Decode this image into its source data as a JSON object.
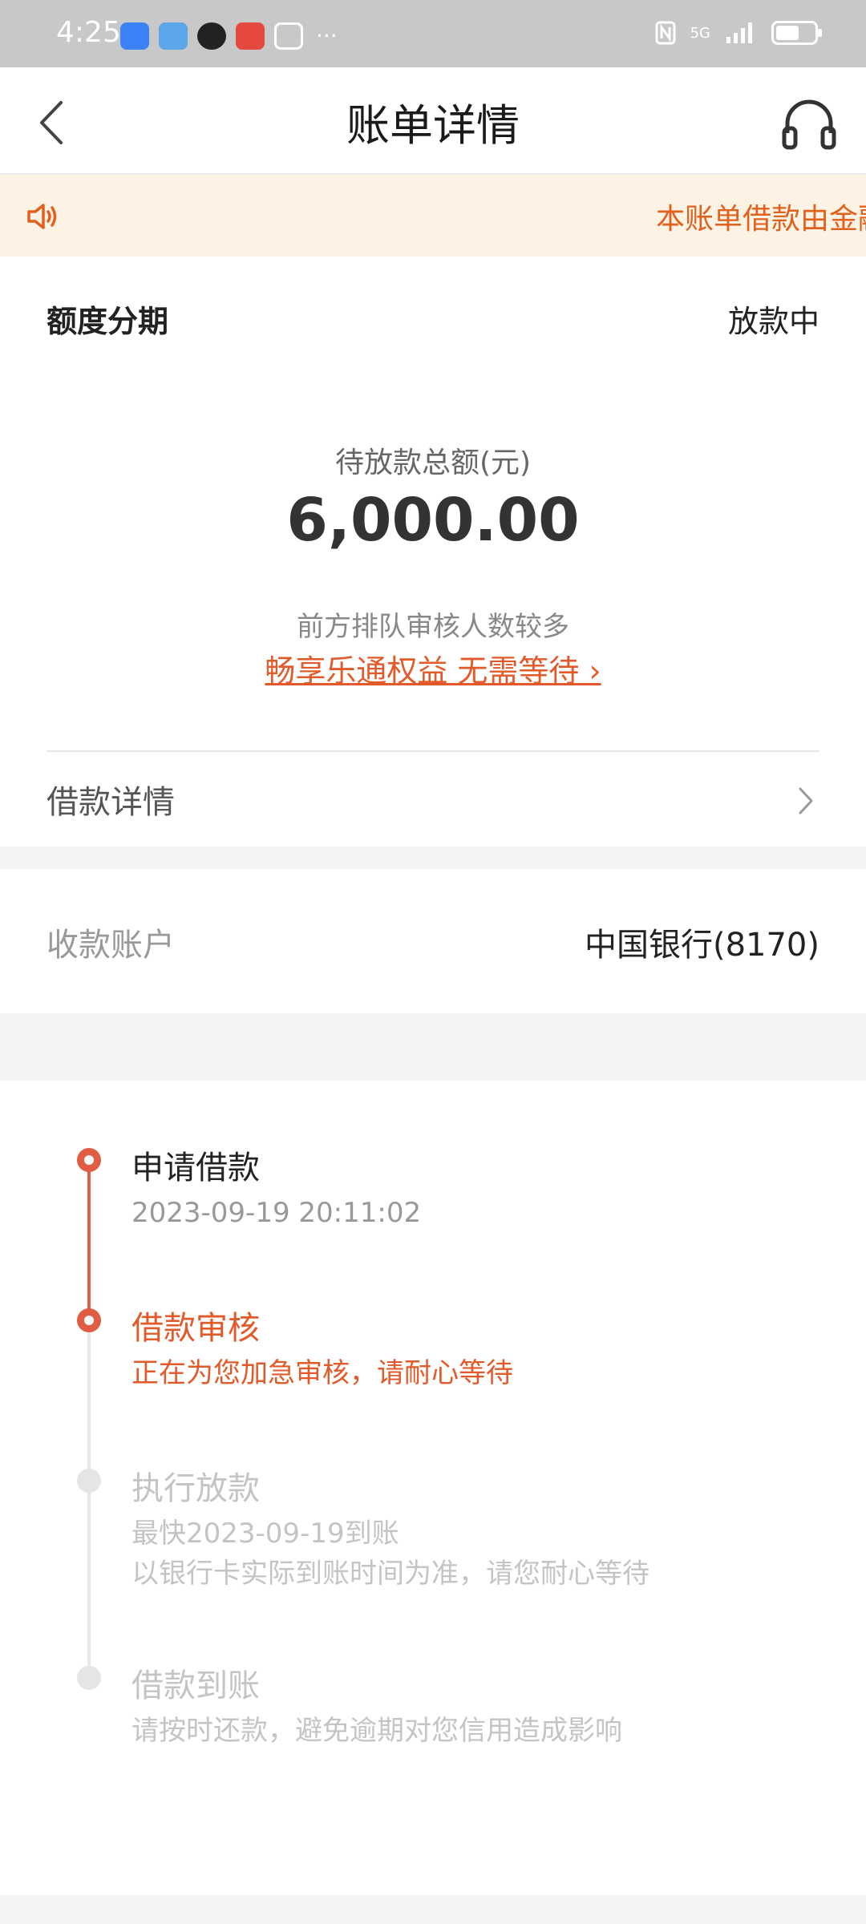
{
  "status_bar": {
    "time": "4:25",
    "app_icons": [
      "browser-icon",
      "weather-icon",
      "qq-icon",
      "book-icon",
      "alipay-icon"
    ],
    "more": "···",
    "network": "5G",
    "battery_level": 0.6
  },
  "nav": {
    "title": "账单详情",
    "back_icon": "back-chevron-icon",
    "service_icon": "headset-icon"
  },
  "notice": {
    "text": "本账单借款由金融"
  },
  "loan": {
    "type_label": "额度分期",
    "status": "放款中",
    "amount_caption": "待放款总额(元)",
    "amount": "6,000.00",
    "queue_text": "前方排队审核人数较多",
    "vip_link": "畅享乐通权益 无需等待 ›",
    "detail_label": "借款详情"
  },
  "account": {
    "label": "收款账户",
    "value": "中国银行(8170)"
  },
  "timeline": [
    {
      "title": "申请借款",
      "lines": [
        "2023-09-19 20:11:02"
      ],
      "state": "done"
    },
    {
      "title": "借款审核",
      "lines": [
        "正在为您加急审核，请耐心等待"
      ],
      "state": "current"
    },
    {
      "title": "执行放款",
      "lines": [
        "最快2023-09-19到账",
        "以银行卡实际到账时间为准，请您耐心等待"
      ],
      "state": "pending"
    },
    {
      "title": "借款到账",
      "lines": [
        "请按时还款，避免逾期对您信用造成影响"
      ],
      "state": "pending"
    }
  ],
  "colors": {
    "accent": "#e35a2a",
    "timeline_active": "#e05d44",
    "notice_bg": "#fdf3e5"
  }
}
